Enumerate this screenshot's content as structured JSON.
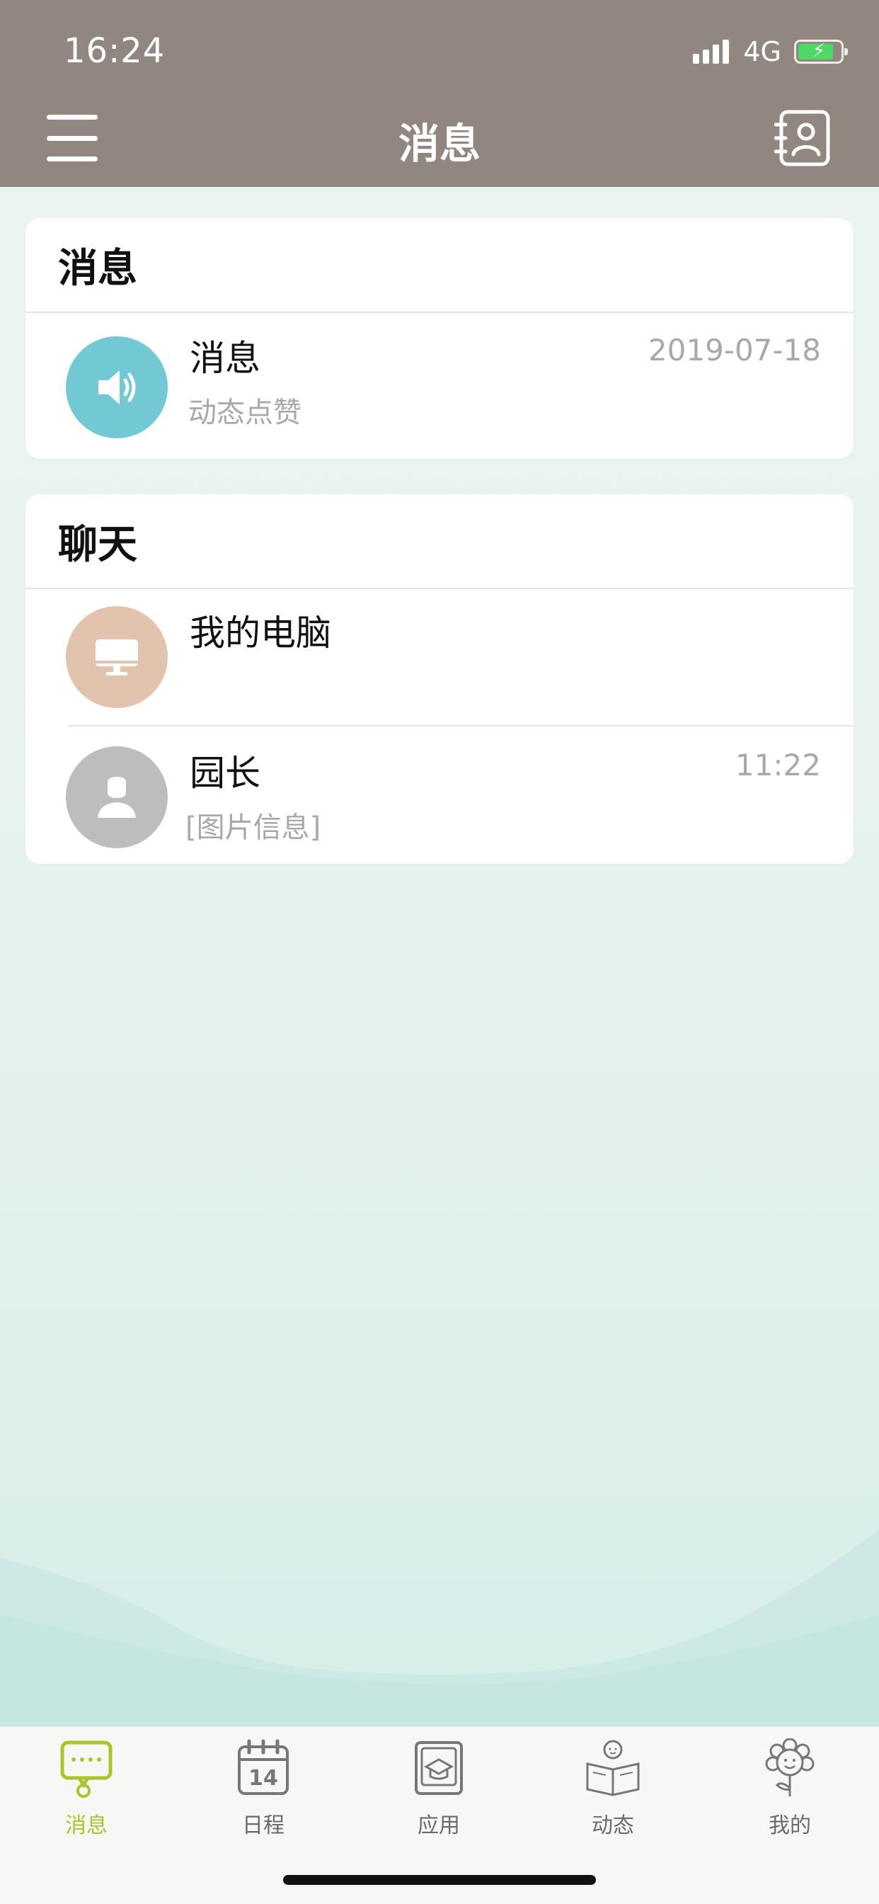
{
  "status_bar": {
    "time": "16:24",
    "network": "4G",
    "battery_charging": true,
    "battery_level": 0.85
  },
  "header": {
    "title": "消息",
    "menu_icon": "hamburger-menu-icon",
    "contacts_icon": "contacts-book-icon"
  },
  "colors": {
    "header_bg": "#928780",
    "accent_active_tab": "#a8c52a",
    "notice_avatar": "#72c8d3",
    "computer_avatar": "#e2c3ad",
    "user_avatar": "#bdbdbd"
  },
  "messages_section": {
    "title": "消息",
    "items": [
      {
        "title": "消息",
        "subtitle": "动态点赞",
        "time": "2019-07-18",
        "icon": "speaker-icon"
      }
    ]
  },
  "chat_section": {
    "title": "聊天",
    "items": [
      {
        "title": "我的电脑",
        "subtitle": "",
        "time": "",
        "icon": "monitor-icon"
      },
      {
        "title": "园长",
        "subtitle": "[图片信息]",
        "time": "11:22",
        "icon": "person-icon"
      }
    ]
  },
  "tabbar": {
    "tabs": [
      {
        "label": "消息",
        "icon": "chat-bubble-icon",
        "active": true
      },
      {
        "label": "日程",
        "icon": "calendar-icon",
        "active": false,
        "icon_text": "14"
      },
      {
        "label": "应用",
        "icon": "apps-icon",
        "active": false
      },
      {
        "label": "动态",
        "icon": "reading-child-icon",
        "active": false
      },
      {
        "label": "我的",
        "icon": "flower-face-icon",
        "active": false
      }
    ]
  }
}
